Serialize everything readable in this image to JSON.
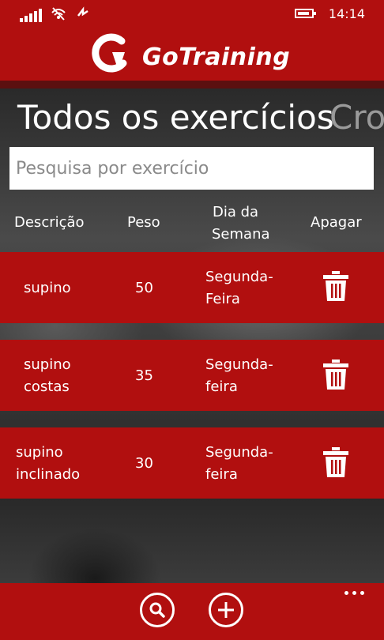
{
  "status_bar": {
    "time": "14:14",
    "icons": [
      "signal-icon",
      "wifi-icon",
      "data-sync-icon",
      "battery-charging-icon"
    ]
  },
  "header": {
    "brand": "GoTraining",
    "logo_icon": "gotraining-logo-icon"
  },
  "pivot": {
    "active_title": "Todos os exercícios",
    "next_title": "Cro"
  },
  "search": {
    "placeholder": "Pesquisa por exercício",
    "value": ""
  },
  "table": {
    "headers": {
      "description": "Descrição",
      "weight": "Peso",
      "day_line1": "Dia da",
      "day_line2": "Semana",
      "delete": "Apagar"
    },
    "rows": [
      {
        "desc1": "supino",
        "desc2": "",
        "weight": "50",
        "day1": "Segunda-",
        "day2": "Feira"
      },
      {
        "desc1": "supino",
        "desc2": "costas",
        "weight": "35",
        "day1": "Segunda-",
        "day2": "feira"
      },
      {
        "desc1": "supino",
        "desc2": "inclinado",
        "weight": "30",
        "day1": "Segunda-",
        "day2": "feira"
      }
    ]
  },
  "app_bar": {
    "buttons": [
      "search-icon",
      "add-icon"
    ],
    "more": "more-icon"
  },
  "colors": {
    "accent": "#b10f0f",
    "header_shadow": "#5b1010",
    "text": "#ffffff"
  }
}
